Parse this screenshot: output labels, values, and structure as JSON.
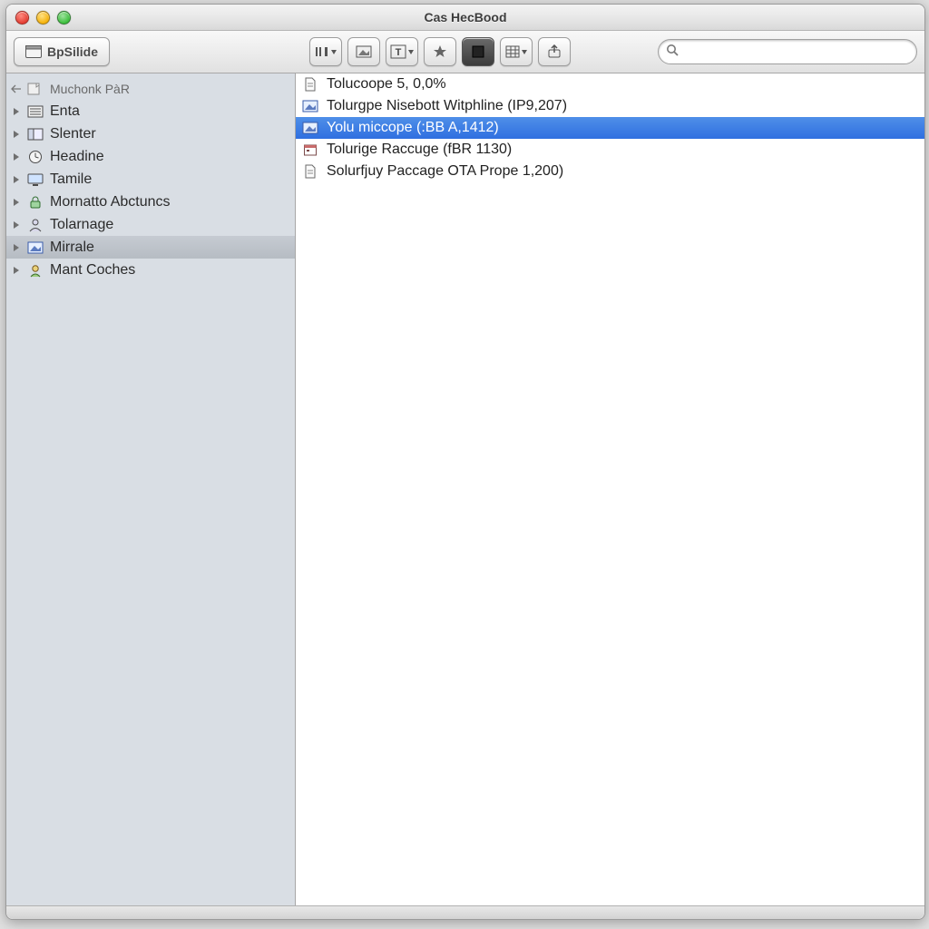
{
  "window": {
    "title": "Cas HecBood"
  },
  "toolbar": {
    "primary_button": "BpSilide",
    "icons": [
      "sliders",
      "picture",
      "text",
      "star",
      "square",
      "grid",
      "share"
    ]
  },
  "search": {
    "placeholder": ""
  },
  "sidebar": {
    "root": "Muchonk PàR",
    "items": [
      {
        "label": "Enta",
        "icon": "list",
        "selected": false
      },
      {
        "label": "Slenter",
        "icon": "panel",
        "selected": false
      },
      {
        "label": "Headine",
        "icon": "clock",
        "selected": false
      },
      {
        "label": "Tamile",
        "icon": "screen",
        "selected": false
      },
      {
        "label": "Mornatto Abctuncs",
        "icon": "lock",
        "selected": false
      },
      {
        "label": "Tolarnage",
        "icon": "person",
        "selected": false
      },
      {
        "label": "Mirrale",
        "icon": "picture",
        "selected": true
      },
      {
        "label": "Mant Coches",
        "icon": "user",
        "selected": false
      }
    ]
  },
  "content": {
    "rows": [
      {
        "icon": "doc",
        "label": "Tolucoope 5, 0,0%",
        "selected": false
      },
      {
        "icon": "picture",
        "label": "Tolurgpe Nisebott Witphline (IP9,207)",
        "selected": false
      },
      {
        "icon": "picture",
        "label": "Yolu miccope  (:BB A,1412)",
        "selected": true
      },
      {
        "icon": "cal",
        "label": "Tolurige Raccuge (fBR 1130)",
        "selected": false
      },
      {
        "icon": "doc",
        "label": "Solurfjuy Paccage  OTA Prope 1,200)",
        "selected": false
      }
    ]
  }
}
